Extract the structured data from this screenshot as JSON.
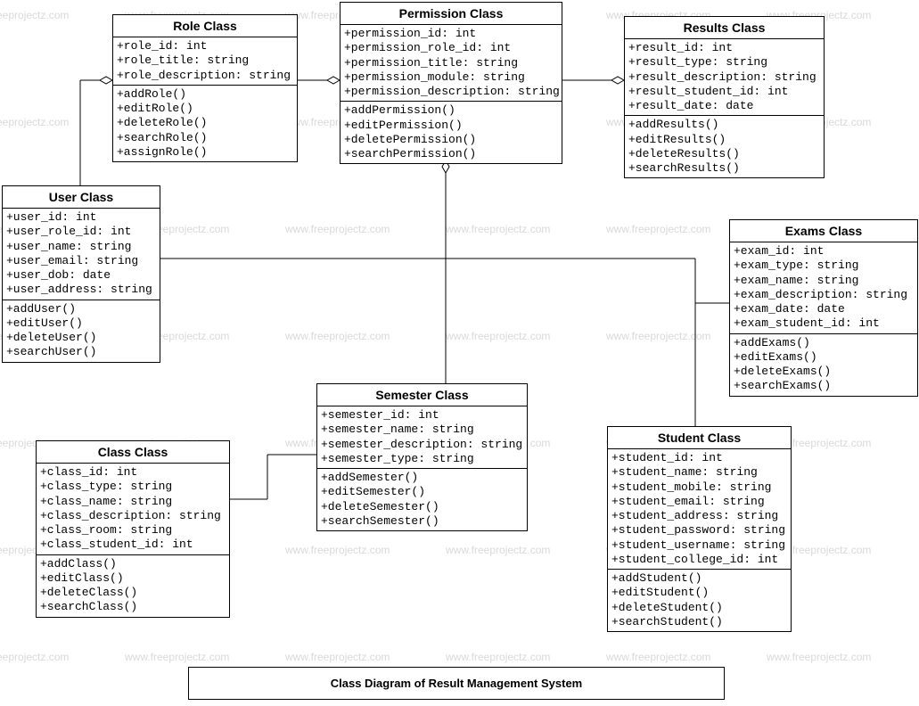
{
  "watermark": "www.freeprojectz.com",
  "title": "Class Diagram of Result Management System",
  "classes": {
    "role": {
      "name": "Role Class",
      "attrs": [
        "+role_id: int",
        "+role_title: string",
        "+role_description: string"
      ],
      "ops": [
        "+addRole()",
        "+editRole()",
        "+deleteRole()",
        "+searchRole()",
        "+assignRole()"
      ]
    },
    "permission": {
      "name": "Permission Class",
      "attrs": [
        "+permission_id: int",
        "+permission_role_id: int",
        "+permission_title: string",
        "+permission_module: string",
        "+permission_description: string"
      ],
      "ops": [
        "+addPermission()",
        "+editPermission()",
        "+deletePermission()",
        "+searchPermission()"
      ]
    },
    "results": {
      "name": "Results Class",
      "attrs": [
        "+result_id: int",
        "+result_type: string",
        "+result_description: string",
        "+result_student_id: int",
        "+result_date: date"
      ],
      "ops": [
        "+addResults()",
        "+editResults()",
        "+deleteResults()",
        "+searchResults()"
      ]
    },
    "user": {
      "name": "User Class",
      "attrs": [
        "+user_id: int",
        "+user_role_id: int",
        "+user_name: string",
        "+user_email: string",
        "+user_dob: date",
        "+user_address: string"
      ],
      "ops": [
        "+addUser()",
        "+editUser()",
        "+deleteUser()",
        "+searchUser()"
      ]
    },
    "exams": {
      "name": "Exams Class",
      "attrs": [
        "+exam_id: int",
        "+exam_type: string",
        "+exam_name: string",
        "+exam_description: string",
        "+exam_date: date",
        "+exam_student_id: int"
      ],
      "ops": [
        "+addExams()",
        "+editExams()",
        "+deleteExams()",
        "+searchExams()"
      ]
    },
    "semester": {
      "name": "Semester Class",
      "attrs": [
        "+semester_id: int",
        "+semester_name: string",
        "+semester_description: string",
        "+semester_type: string"
      ],
      "ops": [
        "+addSemester()",
        "+editSemester()",
        "+deleteSemester()",
        "+searchSemester()"
      ]
    },
    "classcls": {
      "name": "Class Class",
      "attrs": [
        "+class_id: int",
        "+class_type: string",
        "+class_name: string",
        "+class_description: string",
        "+class_room: string",
        "+class_student_id: int"
      ],
      "ops": [
        "+addClass()",
        "+editClass()",
        "+deleteClass()",
        "+searchClass()"
      ]
    },
    "student": {
      "name": "Student Class",
      "attrs": [
        "+student_id: int",
        "+student_name: string",
        "+student_mobile: string",
        "+student_email: string",
        "+student_address: string",
        "+student_password: string",
        "+student_username: string",
        "+student_college_id: int"
      ],
      "ops": [
        "+addStudent()",
        "+editStudent()",
        "+deleteStudent()",
        "+searchStudent()"
      ]
    }
  }
}
